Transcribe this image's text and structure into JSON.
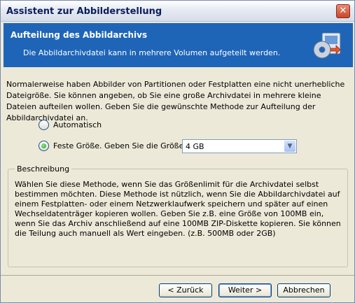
{
  "window": {
    "title": "Assistent zur Abbilderstellung",
    "close_glyph": "✕"
  },
  "header": {
    "title": "Aufteilung des Abbildarchivs",
    "subtitle": "Die Abbildarchivdatei kann in mehrere Volumen aufgeteilt werden.",
    "icon": "disk-image-icon",
    "background": "#1e65b8"
  },
  "intro_text": "Normalerweise haben Abbilder von Partitionen oder Festplatten eine nicht unerhebliche Dateigröße. Sie können angeben, ob Sie eine große Archivdatei in mehrere kleine Dateien aufteilen wollen. Geben Sie die gewünschte Methode zur Aufteilung der Abbildarchivdatei an.",
  "options": {
    "automatic": {
      "label": "Automatisch",
      "checked": false
    },
    "fixed": {
      "label": "Feste Größe. Geben Sie die Größe an:",
      "checked": true
    }
  },
  "size_select": {
    "value": "4 GB",
    "arrow_glyph": "▼"
  },
  "description": {
    "legend": "Beschreibung",
    "text": "Wählen Sie diese Methode, wenn Sie das Größenlimit für die Archivdatei selbst bestimmen möchten. Diese Methode ist nützlich, wenn Sie die Abbildarchivdatei auf einem Festplatten- oder einem Netzwerklaufwerk speichern und später auf einen Wechseldatenträger kopieren wollen. Geben Sie z.B. eine Größe von 100MB ein, wenn Sie das Archiv anschließend auf eine 100MB ZIP-Diskette kopieren. Sie können die Teilung auch manuell als Wert eingeben. (z.B. 500MB oder 2GB)"
  },
  "buttons": {
    "back": "< Zurück",
    "next": "Weiter >",
    "cancel": "Abbrechen"
  }
}
